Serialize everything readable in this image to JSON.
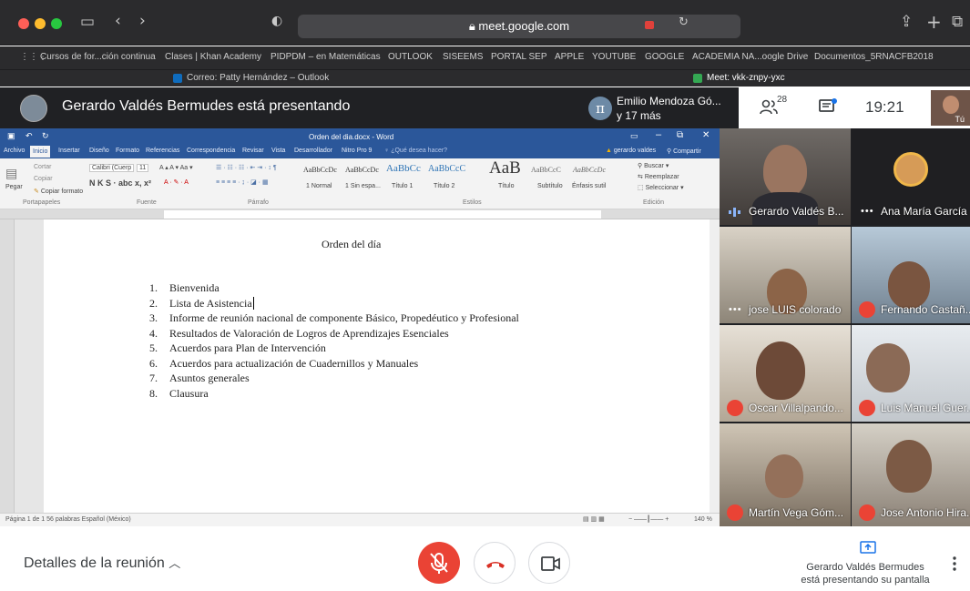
{
  "browser": {
    "url": "meet.google.com",
    "bookmarks": [
      "Cursos de for...ción continua",
      "Clases | Khan Academy",
      "PIDPDM – en Matemáticas",
      "OUTLOOK",
      "SISEEMS",
      "PORTAL SEP",
      "APPLE",
      "YOUTUBE",
      "GOOGLE",
      "ACADEMIA NA...oogle Drive",
      "Documentos_5RNACFB2018"
    ],
    "tabs": [
      {
        "label": "Correo: Patty Hernández – Outlook"
      },
      {
        "label": "Meet: vkk-znpy-yxc"
      }
    ]
  },
  "meet": {
    "presenting_title": "Gerardo Valdés Bermudes está presentando",
    "participants_text_line1": "Emilio Mendoza Gó...",
    "participants_text_line2": "y 17 más",
    "participant_count": "28",
    "time": "19:21",
    "self_label": "Tú",
    "pi_symbol": "π"
  },
  "word": {
    "window_title": "Orden del dia.docx - Word",
    "user": "gerardo valdes",
    "share_label": "Compartir",
    "search_hint": "¿Qué desea hacer?",
    "ribbon_tabs": [
      "Archivo",
      "Inicio",
      "Insertar",
      "Diseño",
      "Formato",
      "Referencias",
      "Correspondencia",
      "Revisar",
      "Vista",
      "Desarrollador",
      "Nitro Pro 9"
    ],
    "font_name": "Calibri (Cuerp",
    "font_size": "11",
    "clipboard": {
      "cut": "Cortar",
      "copy": "Copiar",
      "paste": "Pegar",
      "format": "Copiar formato"
    },
    "groups": [
      "Portapapeles",
      "Fuente",
      "Párrafo",
      "Estilos",
      "Edición"
    ],
    "styles": [
      {
        "sample": "AaBbCcDc",
        "name": "1 Normal"
      },
      {
        "sample": "AaBbCcDc",
        "name": "1 Sin espa..."
      },
      {
        "sample": "AaBbCc",
        "name": "Título 1"
      },
      {
        "sample": "AaBbCcC",
        "name": "Título 2"
      },
      {
        "sample": "AaB",
        "name": "Título"
      },
      {
        "sample": "AaBbCcC",
        "name": "Subtítulo"
      },
      {
        "sample": "AaBbCcDc",
        "name": "Énfasis sutil"
      }
    ],
    "editing": [
      "Buscar",
      "Reemplazar",
      "Seleccionar"
    ],
    "doc_title": "Orden del día",
    "items": [
      "Bienvenida",
      "Lista de Asistencia",
      "Informe de reunión nacional de componente Básico, Propedéutico y Profesional",
      "Resultados de Valoración de Logros de Aprendizajes Esenciales",
      "Acuerdos para Plan de Intervención",
      "Acuerdos para actualización de Cuadernillos y Manuales",
      "Asuntos generales",
      "Clausura"
    ],
    "status_text": "Página 1 de 1   56 palabras   Español (México)",
    "zoom": "140 %"
  },
  "tiles": [
    {
      "name": "Gerardo Valdés B...",
      "status": "speaking"
    },
    {
      "name": "Ana María García",
      "status": "more"
    },
    {
      "name": "jose LUIS colorado",
      "status": "more"
    },
    {
      "name": "Fernando Castañ...",
      "status": "muted"
    },
    {
      "name": "Oscar Villalpando...",
      "status": "muted"
    },
    {
      "name": "Luis Manuel Guer...",
      "status": "muted"
    },
    {
      "name": "Martín Vega Góm...",
      "status": "muted"
    },
    {
      "name": "Jose Antonio Hira...",
      "status": "muted"
    }
  ],
  "bottom": {
    "details": "Detalles de la reunión",
    "present_note_line1": "Gerardo Valdés Bermudes",
    "present_note_line2": "está presentando su pantalla"
  },
  "colors": {
    "meet_dark": "#202124",
    "word_blue": "#2b579a",
    "mic_red": "#ea4335"
  }
}
